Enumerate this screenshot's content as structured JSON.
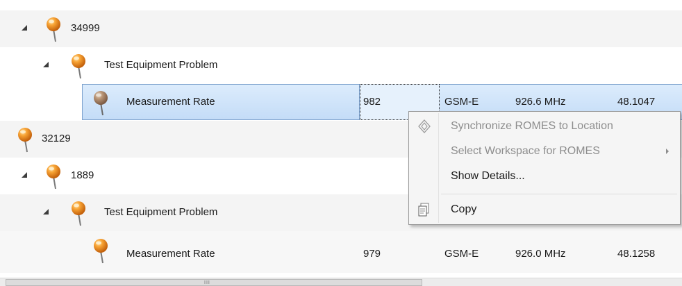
{
  "rows": [
    {
      "label": "34999"
    },
    {
      "label": "Test Equipment Problem"
    },
    {
      "label": "Measurement Rate",
      "value": "982",
      "tech": "GSM-E",
      "freq": "926.6 MHz",
      "coord": "48.1047"
    },
    {
      "label": "32129"
    },
    {
      "label": "1889"
    },
    {
      "label": "Test Equipment Problem"
    },
    {
      "label": "Measurement Rate",
      "value": "979",
      "tech": "GSM-E",
      "freq": "926.0 MHz",
      "coord": "48.1258"
    }
  ],
  "context_menu": {
    "items": [
      {
        "label": "Synchronize ROMES to Location",
        "enabled": false,
        "icon": "diamond-icon"
      },
      {
        "label": "Select Workspace for ROMES",
        "enabled": false,
        "submenu": true
      },
      {
        "label": "Show Details...",
        "enabled": true
      },
      {
        "label": "Copy",
        "enabled": true,
        "icon": "copy-icon"
      }
    ]
  },
  "scrollbar": {
    "grip": "III"
  },
  "colors": {
    "pin": "#f08a1c",
    "selection": "#cfe3fa",
    "menu_bg": "#f5f5f5"
  }
}
